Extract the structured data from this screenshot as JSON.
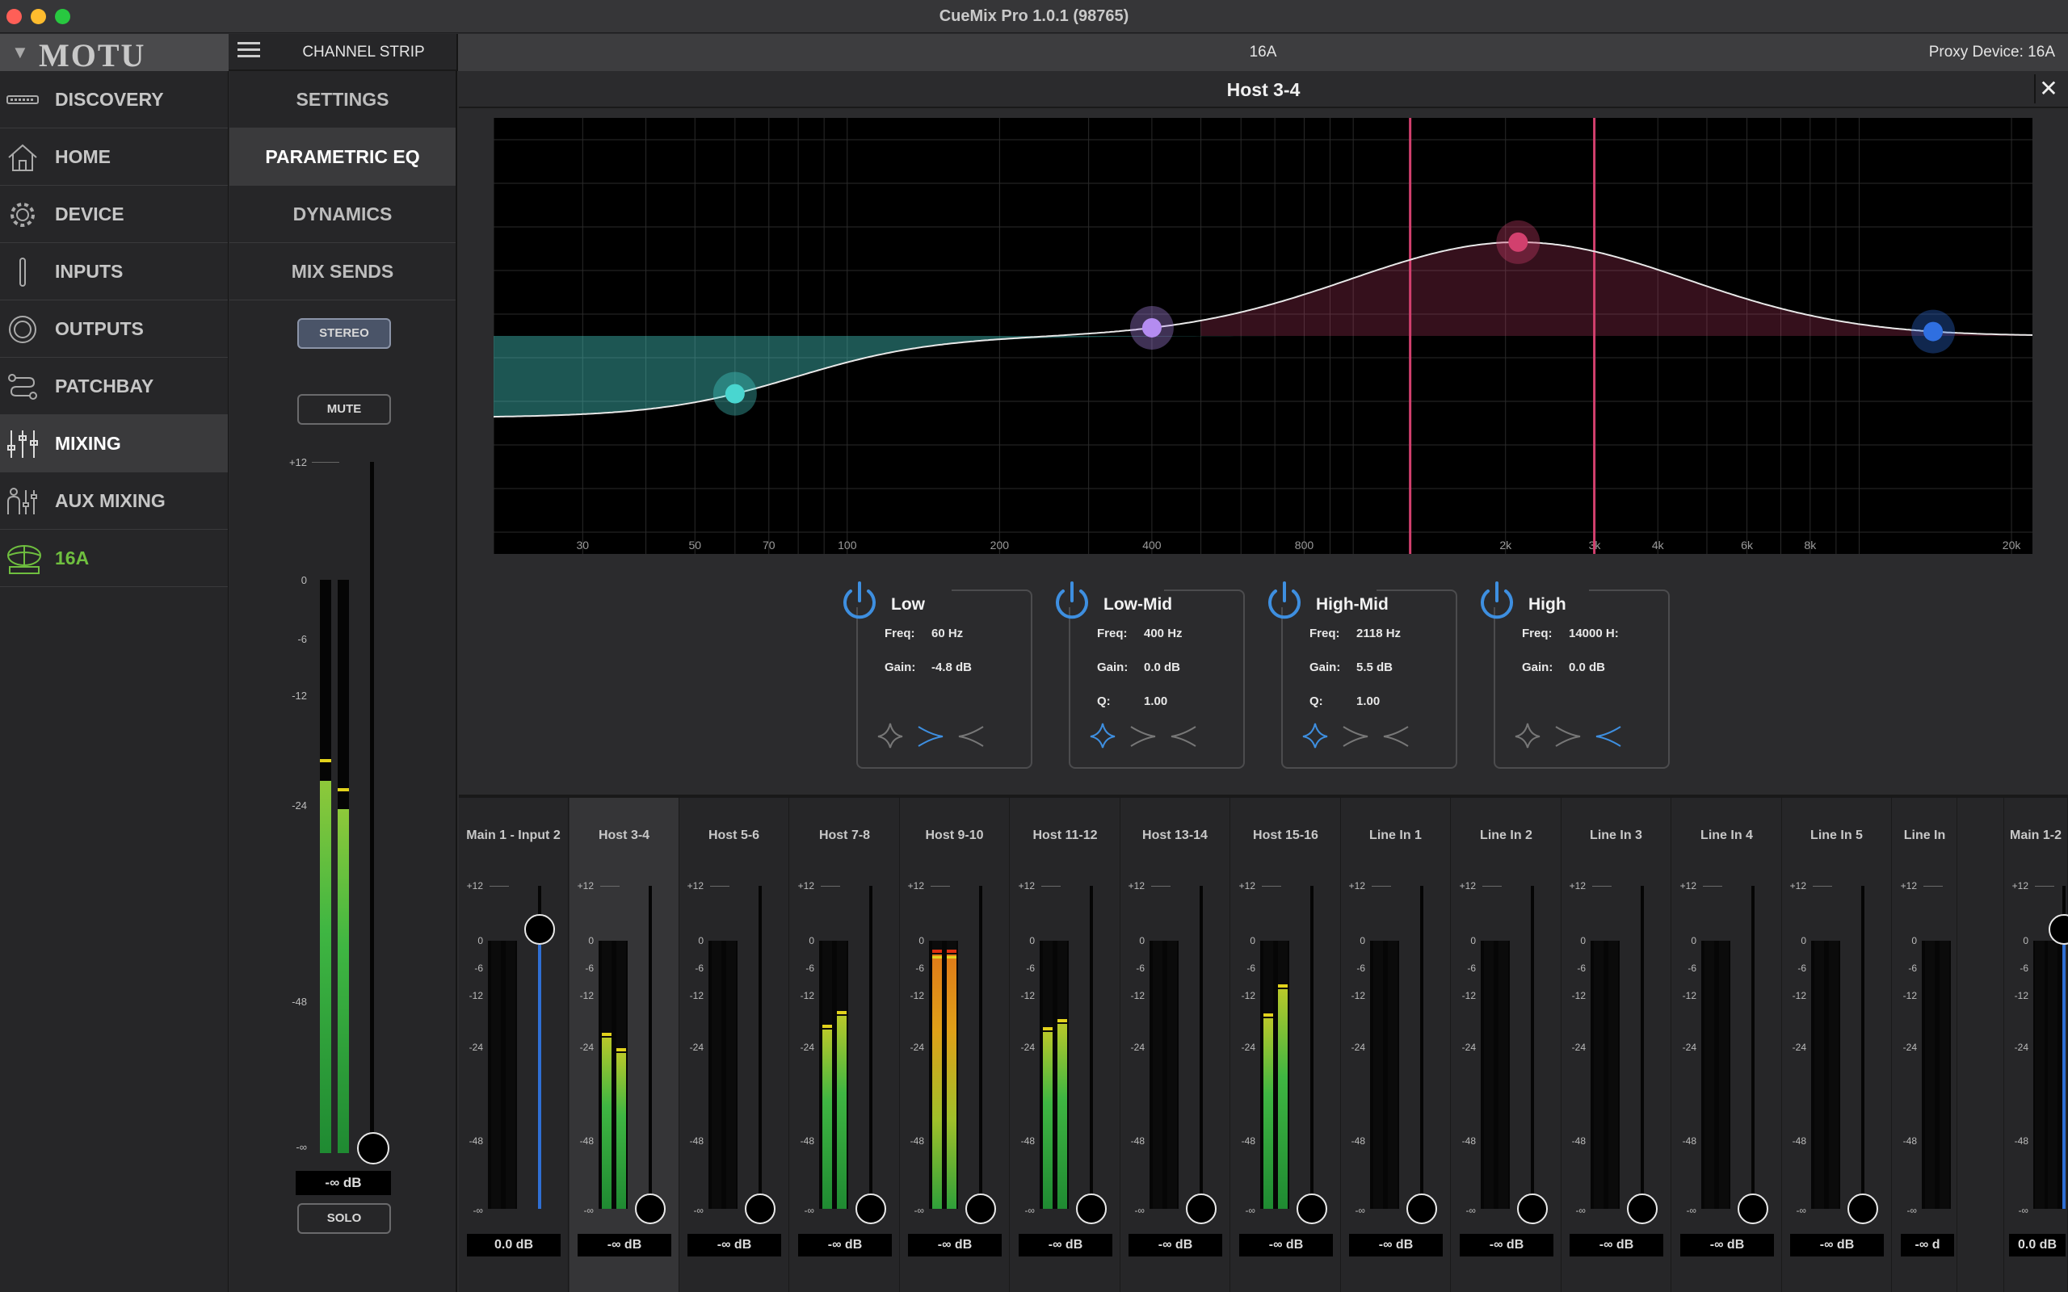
{
  "window": {
    "title": "CueMix Pro 1.0.1 (98765)"
  },
  "topbar": {
    "brand": "MOTU",
    "strip_label": "CHANNEL STRIP",
    "device": "16A",
    "proxy": "Proxy Device: 16A"
  },
  "nav": {
    "items": [
      {
        "label": "DISCOVERY",
        "icon": "discovery-icon"
      },
      {
        "label": "HOME",
        "icon": "home-icon"
      },
      {
        "label": "DEVICE",
        "icon": "gear-icon"
      },
      {
        "label": "INPUTS",
        "icon": "inputs-icon"
      },
      {
        "label": "OUTPUTS",
        "icon": "outputs-icon"
      },
      {
        "label": "PATCHBAY",
        "icon": "patchbay-icon"
      },
      {
        "label": "MIXING",
        "icon": "mixing-icon",
        "active": true
      },
      {
        "label": "AUX MIXING",
        "icon": "aux-mixing-icon"
      },
      {
        "label": "16A",
        "icon": "device-16a-icon",
        "accent": "#6fbf3f"
      }
    ]
  },
  "subnav": {
    "items": [
      {
        "label": "SETTINGS"
      },
      {
        "label": "PARAMETRIC EQ",
        "active": true
      },
      {
        "label": "DYNAMICS"
      },
      {
        "label": "MIX SENDS"
      }
    ],
    "stereo_label": "STEREO",
    "mute_label": "MUTE",
    "solo_label": "SOLO",
    "scale": [
      "+12",
      "0",
      "-6",
      "-12",
      "-24",
      "-48",
      "-∞"
    ],
    "fader_value": "-∞ dB"
  },
  "panel": {
    "title": "Host 3-4"
  },
  "eq": {
    "freq_labels": [
      "30",
      "50",
      "70",
      "100",
      "200",
      "400",
      "800",
      "2k",
      "3k",
      "4k",
      "6k",
      "8k",
      "20k"
    ],
    "curve_color": "#e8e8e8",
    "bands": [
      {
        "name": "Low",
        "freq": "60 Hz",
        "gain": "-4.8 dB",
        "q": null,
        "color": "#49d6d0",
        "shape": "low-shelf",
        "enabled": true
      },
      {
        "name": "Low-Mid",
        "freq": "400 Hz",
        "gain": "0.0 dB",
        "q": "1.00",
        "color": "#b48cf0",
        "shape": "peak",
        "enabled": true
      },
      {
        "name": "High-Mid",
        "freq": "2118 Hz",
        "gain": "5.5 dB",
        "q": "1.00",
        "color": "#d2406e",
        "shape": "peak",
        "enabled": true
      },
      {
        "name": "High",
        "freq": "14000 H:",
        "gain": "0.0 dB",
        "q": null,
        "color": "#2f6fe0",
        "shape": "high-shelf",
        "enabled": true
      }
    ],
    "labels": {
      "freq": "Freq:",
      "gain": "Gain:",
      "q": "Q:"
    }
  },
  "mixer": {
    "scale": [
      "+12",
      "0",
      "-6",
      "-12",
      "-24",
      "-48",
      "-∞"
    ],
    "channels": [
      {
        "name": "Main 1 - Input 2",
        "value": "0.0 dB",
        "fader": 0.71,
        "meter_l": 0,
        "meter_r": 0,
        "blue_fader": true
      },
      {
        "name": "Host 3-4",
        "value": "-∞ dB",
        "fader": 0,
        "meter_l": 0.64,
        "meter_r": 0.58,
        "selected": true
      },
      {
        "name": "Host 5-6",
        "value": "-∞ dB",
        "fader": 0,
        "meter_l": 0,
        "meter_r": 0
      },
      {
        "name": "Host 7-8",
        "value": "-∞ dB",
        "fader": 0,
        "meter_l": 0.67,
        "meter_r": 0.72
      },
      {
        "name": "Host 9-10",
        "value": "-∞ dB",
        "fader": 0,
        "meter_l": 0.95,
        "meter_r": 0.95,
        "hot": true
      },
      {
        "name": "Host 11-12",
        "value": "-∞ dB",
        "fader": 0,
        "meter_l": 0.66,
        "meter_r": 0.69
      },
      {
        "name": "Host 13-14",
        "value": "-∞ dB",
        "fader": 0,
        "meter_l": 0,
        "meter_r": 0
      },
      {
        "name": "Host 15-16",
        "value": "-∞ dB",
        "fader": 0,
        "meter_l": 0.71,
        "meter_r": 0.82
      },
      {
        "name": "Line In 1",
        "value": "-∞ dB",
        "fader": 0,
        "meter_l": 0,
        "meter_r": 0
      },
      {
        "name": "Line In 2",
        "value": "-∞ dB",
        "fader": 0,
        "meter_l": 0,
        "meter_r": 0
      },
      {
        "name": "Line In 3",
        "value": "-∞ dB",
        "fader": 0,
        "meter_l": 0,
        "meter_r": 0
      },
      {
        "name": "Line In 4",
        "value": "-∞ dB",
        "fader": 0,
        "meter_l": 0,
        "meter_r": 0
      },
      {
        "name": "Line In 5",
        "value": "-∞ dB",
        "fader": 0,
        "meter_l": 0,
        "meter_r": 0
      },
      {
        "name": "Line In",
        "value": "-∞ d",
        "fader": 0,
        "meter_l": 0,
        "meter_r": 0,
        "clipped": true
      },
      {
        "name": "Main 1-2",
        "value": "0.0 dB",
        "fader": 0.71,
        "meter_l": 0,
        "meter_r": 0,
        "blue_fader": true,
        "narrow": true
      }
    ]
  },
  "colors": {
    "meter_green": "#2fa83a",
    "meter_yellow": "#c9c41f",
    "meter_peak": "#e2d21c",
    "fader_blue": "#2f6fd4",
    "accent_green": "#6fbf3f"
  }
}
